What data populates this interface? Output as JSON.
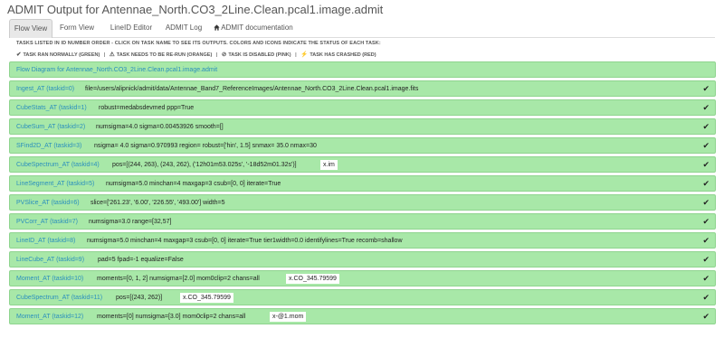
{
  "page": {
    "title": "ADMIT Output for Antennae_North.CO3_2Line.Clean.pcal1.image.admit"
  },
  "tabs": [
    {
      "label": "Flow View",
      "active": true
    },
    {
      "label": "Form View",
      "active": false
    },
    {
      "label": "LineID Editor",
      "active": false
    },
    {
      "label": "ADMIT Log",
      "active": false
    },
    {
      "label": "ADMIT documentation",
      "active": false,
      "icon": "home-icon"
    }
  ],
  "legend": {
    "line1": "TASKS LISTED IN ID NUMBER ORDER - CLICK ON TASK NAME TO SEE ITS OUTPUTS. COLORS AND ICONS INDICATE THE STATUS OF EACH TASK:",
    "ok": "TASK RAN NORMALLY (GREEN)",
    "rerun": "TASK NEEDS TO BE RE-RUN (ORANGE)",
    "disabled": "TASK IS DISABLED (PINK)",
    "crashed": "TASK HAS CRASHED (RED)",
    "separator": "|"
  },
  "flow_diagram": "Flow Diagram for Antennae_North.CO3_2Line.Clean.pcal1.image.admit",
  "colors": {
    "ok_green": "#a8e8a8",
    "link_blue": "#2a8fbd"
  },
  "tasks": [
    {
      "name": "Ingest_AT  (taskid=0)",
      "params": "file=/users/alipnick/admit/data/Antennae_Band7_ReferenceImages/Antennae_North.CO3_2Line.Clean.pcal1.image.fits",
      "output": ""
    },
    {
      "name": "CubeStats_AT  (taskid=1)",
      "params": "robust=medabsdevmed ppp=True",
      "output": ""
    },
    {
      "name": "CubeSum_AT  (taskid=2)",
      "params": "numsigma=4.0 sigma=0.00453926 smooth=[]",
      "output": ""
    },
    {
      "name": "SFind2D_AT  (taskid=3)",
      "params": "nsigma= 4.0 sigma=0.970993 region= robust=['hin', 1.5] snmax= 35.0 nmax=30",
      "output": ""
    },
    {
      "name": "CubeSpectrum_AT  (taskid=4)",
      "params": "pos=[(244, 263), (243, 262), ('12h01m53.025s', '-18d52m01.32s')]",
      "output": "x.im"
    },
    {
      "name": "LineSegment_AT  (taskid=5)",
      "params": "numsigma=5.0 minchan=4 maxgap=3 csub=[0, 0] iterate=True",
      "output": ""
    },
    {
      "name": "PVSlice_AT  (taskid=6)",
      "params": "slice=['261.23', '6.00', '226.55', '493.00'] width=5",
      "output": ""
    },
    {
      "name": "PVCorr_AT  (taskid=7)",
      "params": "numsigma=3.0 range=[32,57]",
      "output": ""
    },
    {
      "name": "LineID_AT  (taskid=8)",
      "params": "numsigma=5.0 minchan=4 maxgap=3 csub=[0, 0] iterate=True tier1width=0.0 identifylines=True recomb=shallow",
      "output": ""
    },
    {
      "name": "LineCube_AT  (taskid=9)",
      "params": "pad=5 fpad=-1 equalize=False",
      "output": ""
    },
    {
      "name": "Moment_AT  (taskid=10)",
      "params": "moments=[0, 1, 2] numsigma=[2.0] mom0clip=2 chans=all",
      "output": "x.CO_345.79599"
    },
    {
      "name": "CubeSpectrum_AT  (taskid=11)",
      "params": "pos=[(243, 262)]",
      "output": "x.CO_345.79599"
    },
    {
      "name": "Moment_AT  (taskid=12)",
      "params": "moments=[0] numsigma=[3.0] mom0clip=2 chans=all",
      "output": "x-@1.mom"
    }
  ]
}
